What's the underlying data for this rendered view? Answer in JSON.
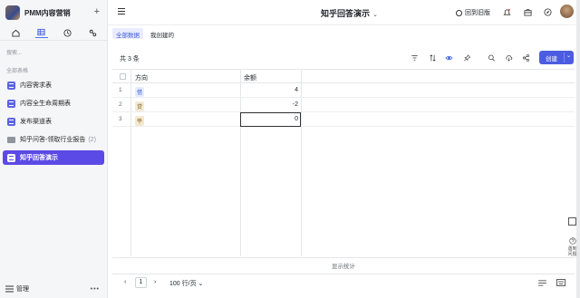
{
  "sidebar": {
    "brand": "PMM内容营销",
    "plus": "+",
    "search_placeholder": "搜索...",
    "section_label": "全部表格",
    "items": [
      {
        "label": "内容需求表"
      },
      {
        "label": "内容全生命周期表"
      },
      {
        "label": "发布渠道表"
      },
      {
        "label": "知乎问答-领取行业报告",
        "count": "(2)"
      },
      {
        "label": "知乎回答演示"
      }
    ],
    "footer_label": "管理",
    "footer_more": "•••"
  },
  "header": {
    "title": "知乎回答演示",
    "title_chevron": "⌄",
    "old_version": "回到旧版"
  },
  "subtabs": [
    "全部数据",
    "我创建的"
  ],
  "toolbar": {
    "count": "共 3 条",
    "create_label": "创建",
    "create_dropdown": "⌄"
  },
  "table": {
    "columns": [
      "方向",
      "余额"
    ],
    "rows": [
      {
        "num": "1",
        "direction": "借",
        "amount": "4"
      },
      {
        "num": "2",
        "direction": "贷",
        "amount": "-2"
      },
      {
        "num": "3",
        "direction": "平",
        "amount": "0"
      }
    ],
    "stats_label": "显示统计"
  },
  "pager": {
    "prev": "‹",
    "page": "1",
    "next": "›",
    "page_size": "100 行/页 ⌄"
  },
  "help": {
    "label": "遇到问题"
  }
}
